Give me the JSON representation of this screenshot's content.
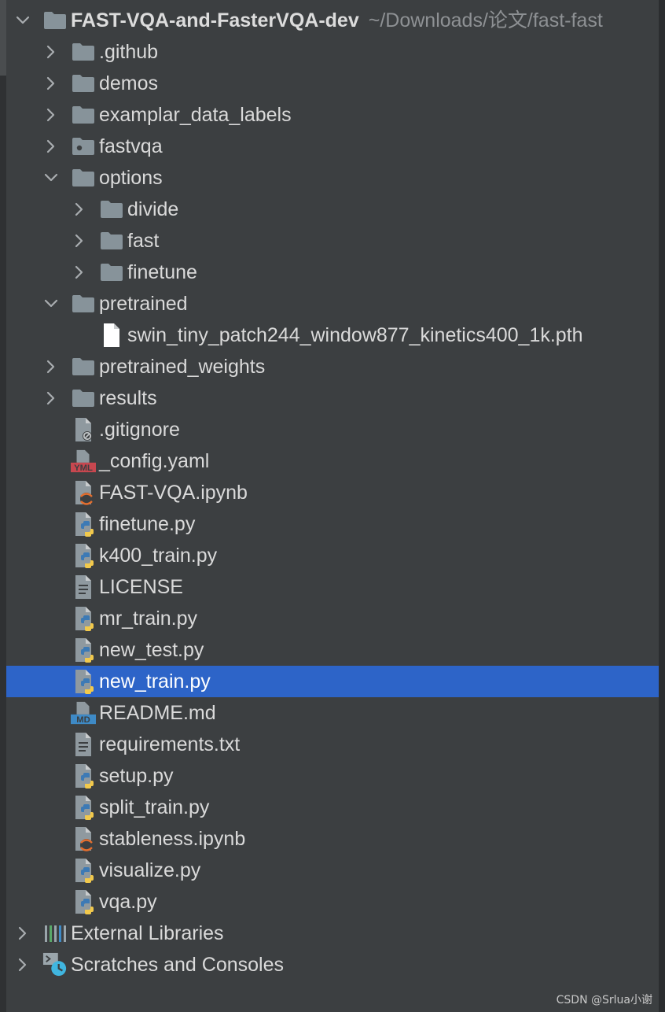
{
  "colors": {
    "background": "#3c3f41",
    "selection": "#2d64c8",
    "text": "#dadada",
    "muted_text": "#8e9194",
    "folder": "#87939a",
    "python_blue": "#3d7ab5",
    "python_yellow": "#f2c94c",
    "yaml_red": "#c7474f",
    "md_blue": "#3e8ac6",
    "jupyter_orange": "#e46e2e"
  },
  "project": {
    "root_name": "FAST-VQA-and-FasterVQA-dev",
    "root_path": "~/Downloads/论文/fast-fast",
    "items": [
      {
        "label": ".github",
        "type": "folder",
        "icon": "folder-icon"
      },
      {
        "label": "demos",
        "type": "folder",
        "icon": "folder-icon"
      },
      {
        "label": "examplar_data_labels",
        "type": "folder",
        "icon": "folder-icon"
      },
      {
        "label": "fastvqa",
        "type": "package",
        "icon": "package-folder-icon"
      },
      {
        "label": "options",
        "type": "folder",
        "icon": "folder-icon",
        "expanded": true,
        "children": [
          {
            "label": "divide",
            "type": "folder",
            "icon": "folder-icon"
          },
          {
            "label": "fast",
            "type": "folder",
            "icon": "folder-icon"
          },
          {
            "label": "finetune",
            "type": "folder",
            "icon": "folder-icon"
          }
        ]
      },
      {
        "label": "pretrained",
        "type": "folder",
        "icon": "folder-icon",
        "expanded": true,
        "children": [
          {
            "label": "swin_tiny_patch244_window877_kinetics400_1k.pth",
            "type": "file",
            "icon": "file-icon"
          }
        ]
      },
      {
        "label": "pretrained_weights",
        "type": "folder",
        "icon": "folder-icon"
      },
      {
        "label": "results",
        "type": "folder",
        "icon": "folder-icon"
      },
      {
        "label": ".gitignore",
        "type": "gitignore",
        "icon": "gitignore-icon"
      },
      {
        "label": "_config.yaml",
        "type": "yaml",
        "icon": "yaml-icon"
      },
      {
        "label": "FAST-VQA.ipynb",
        "type": "ipynb",
        "icon": "jupyter-icon"
      },
      {
        "label": "finetune.py",
        "type": "py",
        "icon": "python-icon"
      },
      {
        "label": "k400_train.py",
        "type": "py",
        "icon": "python-icon"
      },
      {
        "label": "LICENSE",
        "type": "text",
        "icon": "text-file-icon"
      },
      {
        "label": "mr_train.py",
        "type": "py",
        "icon": "python-icon"
      },
      {
        "label": "new_test.py",
        "type": "py",
        "icon": "python-icon"
      },
      {
        "label": "new_train.py",
        "type": "py",
        "icon": "python-icon",
        "selected": true
      },
      {
        "label": "README.md",
        "type": "md",
        "icon": "markdown-icon"
      },
      {
        "label": "requirements.txt",
        "type": "text",
        "icon": "text-file-icon"
      },
      {
        "label": "setup.py",
        "type": "py",
        "icon": "python-icon"
      },
      {
        "label": "split_train.py",
        "type": "py",
        "icon": "python-icon"
      },
      {
        "label": "stableness.ipynb",
        "type": "ipynb",
        "icon": "jupyter-icon"
      },
      {
        "label": "visualize.py",
        "type": "py",
        "icon": "python-icon"
      },
      {
        "label": "vqa.py",
        "type": "py",
        "icon": "python-icon"
      }
    ]
  },
  "external_libraries": {
    "label": "External Libraries",
    "icon": "libraries-icon"
  },
  "scratches": {
    "label": "Scratches and Consoles",
    "icon": "scratches-icon"
  },
  "icon_labels": {
    "yaml": "YML",
    "markdown": "MD"
  },
  "watermark": "CSDN @Srlua小谢"
}
